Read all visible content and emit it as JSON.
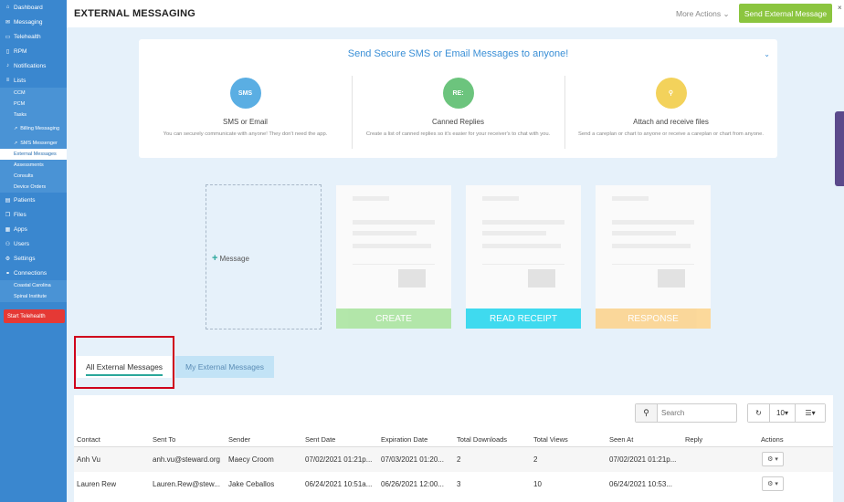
{
  "sidebar": {
    "items": [
      {
        "label": "Dashboard",
        "icon": "dashboard-icon",
        "glyph": "⌂"
      },
      {
        "label": "Messaging",
        "icon": "chat-icon",
        "glyph": "✉"
      },
      {
        "label": "Telehealth",
        "icon": "video-icon",
        "glyph": "▭"
      },
      {
        "label": "RPM",
        "icon": "device-icon",
        "glyph": "▯"
      },
      {
        "label": "Notifications",
        "icon": "bell-icon",
        "glyph": "♪"
      },
      {
        "label": "Lists",
        "icon": "list-icon",
        "glyph": "≡"
      }
    ],
    "list_sub": [
      "CCM",
      "PCM",
      "Tasks",
      "Billing Messaging",
      "SMS Messenger",
      "External Messages",
      "Assessments",
      "Consults",
      "Device Orders"
    ],
    "items2": [
      {
        "label": "Patients",
        "icon": "patients-icon",
        "glyph": "▤"
      },
      {
        "label": "Files",
        "icon": "files-icon",
        "glyph": "❐"
      },
      {
        "label": "Apps",
        "icon": "apps-icon",
        "glyph": "▦"
      },
      {
        "label": "Users",
        "icon": "users-icon",
        "glyph": "⚇"
      },
      {
        "label": "Settings",
        "icon": "gear-icon",
        "glyph": "⚙"
      },
      {
        "label": "Connections",
        "icon": "connections-icon",
        "glyph": "⚭"
      }
    ],
    "connection_sub": [
      "Coastal Carolina",
      "Spinal Institute"
    ],
    "telehealth_button": "Start Telehealth"
  },
  "header": {
    "title": "EXTERNAL MESSAGING",
    "more_actions": "More Actions",
    "send_button": "Send External Message",
    "close": "×"
  },
  "feature": {
    "title": "Send Secure SMS or Email Messages to anyone!",
    "items": [
      {
        "name": "SMS or Email",
        "desc": "You can securely communicate with anyone! They don't need the app.",
        "icon_text": "SMS",
        "color": "#5aaee3"
      },
      {
        "name": "Canned Replies",
        "desc": "Create a list of canned replies so it's easier for your receiver's to chat with you.",
        "icon_text": "RE:",
        "color": "#6cc47d"
      },
      {
        "name": "Attach and receive files",
        "desc": "Send a careplan or chart to anyone or receive a careplan or chart from anyone.",
        "icon_text": "⚲",
        "color": "#f3d25b"
      }
    ]
  },
  "preview": {
    "message_label": "Message",
    "cards": [
      {
        "label": "CREATE",
        "color": "#a6e39b"
      },
      {
        "label": "READ RECEIPT",
        "color": "#1fd5ee"
      },
      {
        "label": "RESPONSE",
        "color": "#fbd28a"
      }
    ]
  },
  "tabs": {
    "all": "All External Messages",
    "my": "My External Messages"
  },
  "table": {
    "search_placeholder": "Search",
    "page_size": "10",
    "columns": [
      "Contact",
      "Sent To",
      "Sender",
      "Sent Date",
      "Expiration Date",
      "Total Downloads",
      "Total Views",
      "Seen At",
      "Reply",
      "Actions"
    ],
    "rows": [
      [
        "Anh Vu",
        "anh.vu@steward.org",
        "Maecy Croom",
        "07/02/2021 01:21p...",
        "07/03/2021 01:20...",
        "2",
        "2",
        "07/02/2021 01:21p...",
        "",
        ""
      ],
      [
        "Lauren Rew",
        "Lauren.Rew@stew...",
        "Jake Ceballos",
        "06/24/2021 10:51a...",
        "06/26/2021 12:00...",
        "3",
        "10",
        "06/24/2021 10:53...",
        "",
        ""
      ]
    ]
  }
}
